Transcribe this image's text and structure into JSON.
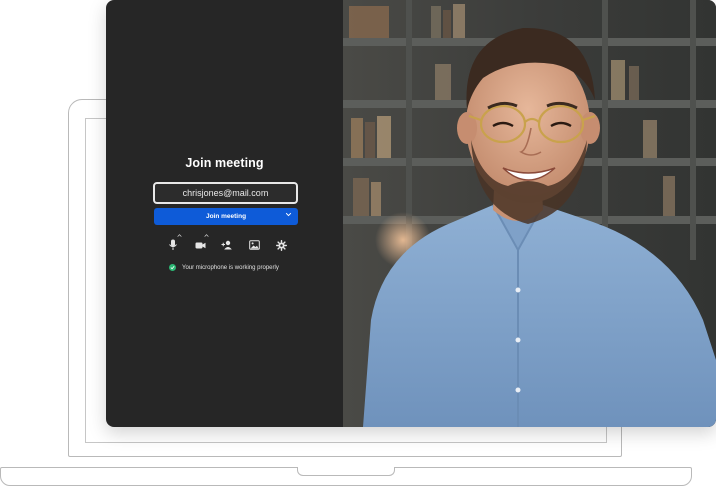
{
  "join": {
    "title": "Join meeting",
    "email_value": "chrisjones@mail.com",
    "button_label": "Join meeting"
  },
  "toolbar": {
    "icons": [
      "microphone-icon",
      "camera-icon",
      "add-person-icon",
      "image-icon",
      "settings-icon"
    ]
  },
  "status": {
    "text": "Your microphone is working properly",
    "color": "#2bb673"
  },
  "colors": {
    "panel": "#262626",
    "accent": "#0e5bd8"
  }
}
